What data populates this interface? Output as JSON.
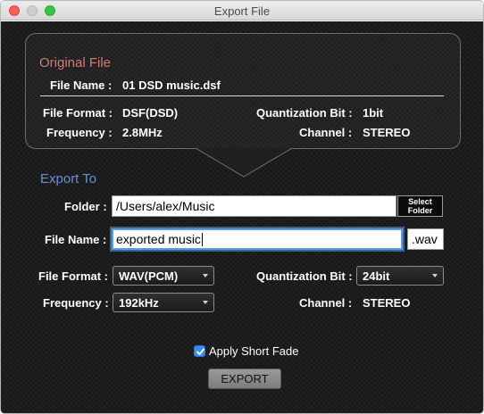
{
  "window": {
    "title": "Export File"
  },
  "original": {
    "heading": "Original File",
    "file_name_label": "File Name :",
    "file_name": "01 DSD music.dsf",
    "format_label": "File Format :",
    "format": "DSF(DSD)",
    "quant_label": "Quantization Bit :",
    "quant": "1bit",
    "freq_label": "Frequency :",
    "freq": "2.8MHz",
    "channel_label": "Channel :",
    "channel": "STEREO"
  },
  "export": {
    "heading": "Export To",
    "folder_label": "Folder :",
    "folder_value": "/Users/alex/Music",
    "select_folder_label_1": "Select",
    "select_folder_label_2": "Folder",
    "filename_label": "File Name :",
    "filename_value": "exported music",
    "extension": ".wav",
    "format_label": "File Format :",
    "format_value": "WAV(PCM)",
    "quant_label": "Quantization Bit :",
    "quant_value": "24bit",
    "freq_label": "Frequency :",
    "freq_value": "192kHz",
    "channel_label": "Channel :",
    "channel_value": "STEREO",
    "fade_label": "Apply Short Fade",
    "fade_checked": true,
    "export_button": "EXPORT"
  },
  "colors": {
    "original_heading": "#d67a7a",
    "export_heading": "#6e8ed6",
    "checkbox": "#3b8cf0",
    "focus_ring": "#5b9ee8"
  }
}
